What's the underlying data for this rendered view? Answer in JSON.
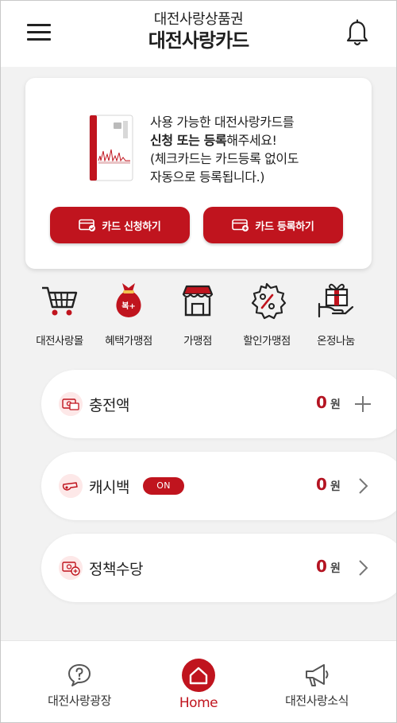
{
  "header": {
    "title_top": "대전사랑상품권",
    "title_main": "대전사랑카드"
  },
  "card_panel": {
    "line1": "사용 가능한 대전사랑카드를",
    "line2_bold": "신청 또는 등록",
    "line2_rest": "해주세요!",
    "line3": "(체크카드는 카드등록 없이도",
    "line4": "자동으로 등록됩니다.)",
    "apply_button": "카드 신청하기",
    "register_button": "카드 등록하기"
  },
  "categories": [
    {
      "label": "대전사랑몰",
      "icon": "cart-icon"
    },
    {
      "label": "혜택가맹점",
      "icon": "lucky-bag-icon",
      "icon_text": "복+"
    },
    {
      "label": "가맹점",
      "icon": "storefront-icon"
    },
    {
      "label": "할인가맹점",
      "icon": "discount-badge-icon"
    },
    {
      "label": "온정나눔",
      "icon": "gift-hand-icon"
    }
  ],
  "balances": [
    {
      "label": "충전액",
      "amount": "0",
      "unit": "원",
      "action": "plus-icon"
    },
    {
      "label": "캐시백",
      "badge": "ON",
      "amount": "0",
      "unit": "원",
      "action": "chevron-right-icon"
    },
    {
      "label": "정책수당",
      "amount": "0",
      "unit": "원",
      "action": "chevron-right-icon"
    }
  ],
  "bottom_nav": [
    {
      "label": "대전사랑광장",
      "icon": "question-bubble-icon"
    },
    {
      "label": "Home",
      "icon": "home-icon",
      "active": true
    },
    {
      "label": "대전사랑소식",
      "icon": "megaphone-icon"
    }
  ],
  "colors": {
    "accent": "#c0141e",
    "amount": "#b41422",
    "background": "#f2f2f2"
  }
}
